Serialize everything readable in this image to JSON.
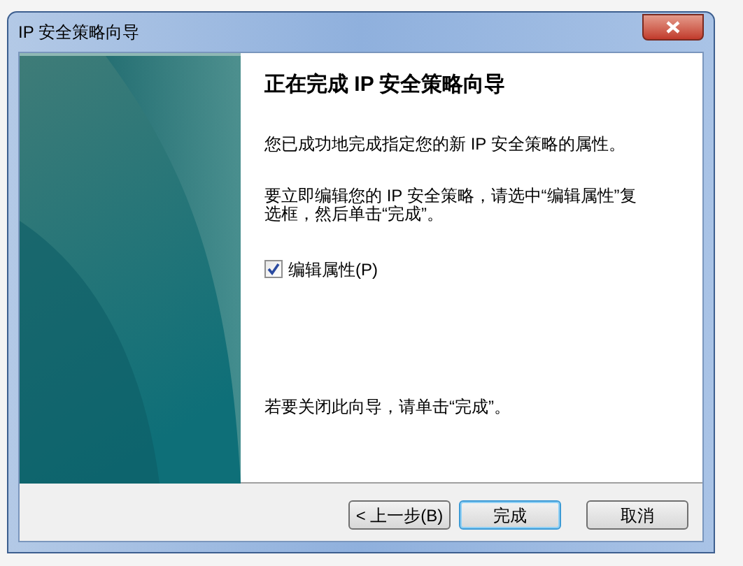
{
  "window": {
    "title": "IP 安全策略向导"
  },
  "heading": "正在完成 IP 安全策略向导",
  "paragraphs": [
    "您已成功地完成指定您的新 IP 安全策略的属性。",
    "要立即编辑您的 IP 安全策略，请选中“编辑属性”复选框，然后单击“完成”。"
  ],
  "checkbox": {
    "label": "编辑属性(P)",
    "checked": true
  },
  "footer_text": "若要关闭此向导，请单击“完成”。",
  "buttons": [
    {
      "label": "< 上一步(B)",
      "default": false
    },
    {
      "label": "完成",
      "default": true
    },
    {
      "label": "取消",
      "default": false
    }
  ]
}
